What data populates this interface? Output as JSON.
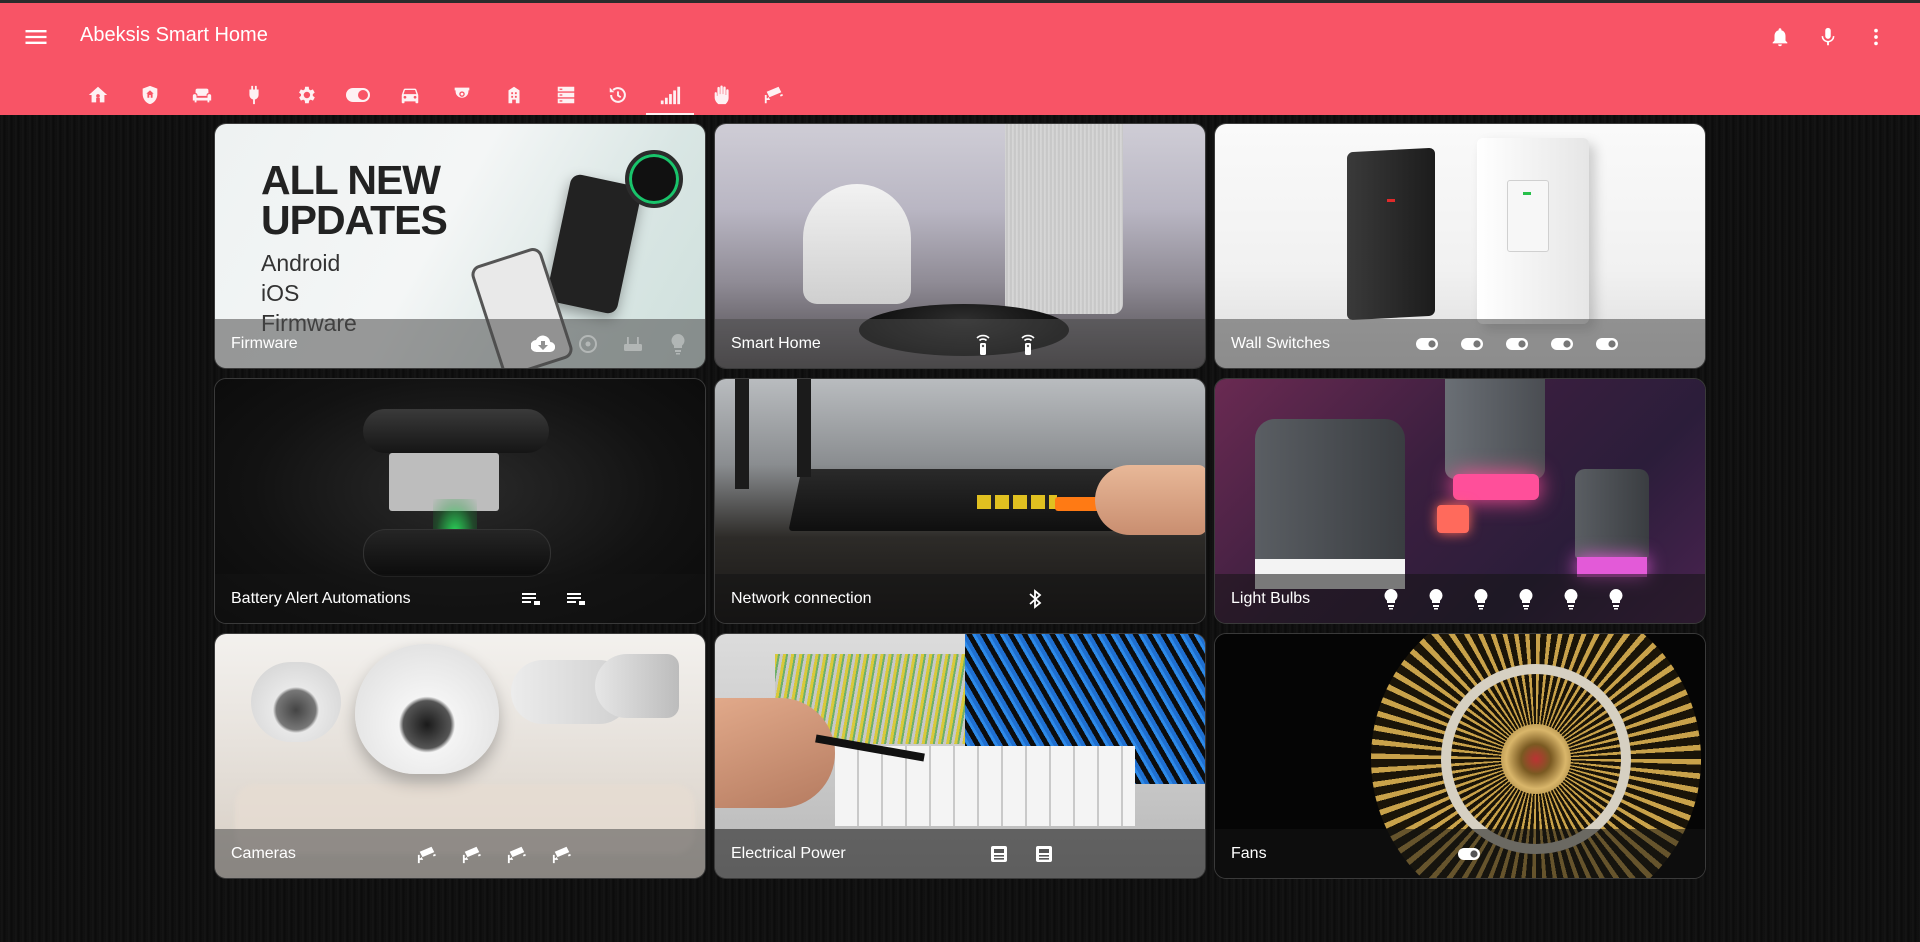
{
  "app": {
    "title": "Abeksis Smart Home"
  },
  "header": {
    "menu_icon": "menu-icon",
    "actions": [
      {
        "name": "notifications-button",
        "icon": "bell-icon"
      },
      {
        "name": "voice-button",
        "icon": "microphone-icon"
      },
      {
        "name": "more-button",
        "icon": "dots-vertical-icon"
      }
    ],
    "tabs": [
      {
        "icon": "home-icon",
        "active": false
      },
      {
        "icon": "shield-home-icon",
        "active": false
      },
      {
        "icon": "sofa-icon",
        "active": false
      },
      {
        "icon": "plug-icon",
        "active": false
      },
      {
        "icon": "gear-icon",
        "active": false
      },
      {
        "icon": "toggle-icon",
        "active": false
      },
      {
        "icon": "car-icon",
        "active": false
      },
      {
        "icon": "cctv-dome-icon",
        "active": false
      },
      {
        "icon": "building-icon",
        "active": false
      },
      {
        "icon": "server-icon",
        "active": false
      },
      {
        "icon": "history-icon",
        "active": false
      },
      {
        "icon": "signal-icon",
        "active": true
      },
      {
        "icon": "hand-icon",
        "active": false
      },
      {
        "icon": "cctv-icon",
        "active": false
      }
    ]
  },
  "colors": {
    "accent": "#f85466",
    "background": "#111111"
  },
  "cards": [
    {
      "name": "Firmware",
      "entities": [
        "cloud-download-icon",
        "disc-icon",
        "router-icon",
        "bulb-icon"
      ],
      "entity_state": [
        "on",
        "off",
        "off",
        "off"
      ]
    },
    {
      "name": "Smart Home",
      "entities": [
        "remote-icon",
        "remote-icon"
      ]
    },
    {
      "name": "Wall Switches",
      "entities": [
        "toggle-icon",
        "toggle-icon",
        "toggle-icon",
        "toggle-icon",
        "toggle-icon"
      ]
    },
    {
      "name": "Battery Alert Automations",
      "entities": [
        "playlist-icon",
        "playlist-icon"
      ]
    },
    {
      "name": "Network connection",
      "entities": [
        "bluetooth-icon"
      ]
    },
    {
      "name": "Light Bulbs",
      "entities": [
        "bulb-icon",
        "bulb-icon",
        "bulb-icon",
        "bulb-icon",
        "bulb-icon",
        "bulb-icon"
      ]
    },
    {
      "name": "Cameras",
      "entities": [
        "cctv-icon",
        "cctv-icon",
        "cctv-icon",
        "cctv-icon"
      ]
    },
    {
      "name": "Electrical Power",
      "entities": [
        "meter-icon",
        "meter-icon"
      ]
    },
    {
      "name": "Fans",
      "entities": [
        "toggle-icon"
      ]
    }
  ],
  "firmware_banner": {
    "headline": [
      "ALL NEW",
      "UPDATES"
    ],
    "platforms": [
      "Android",
      "iOS",
      "Firmware"
    ]
  }
}
